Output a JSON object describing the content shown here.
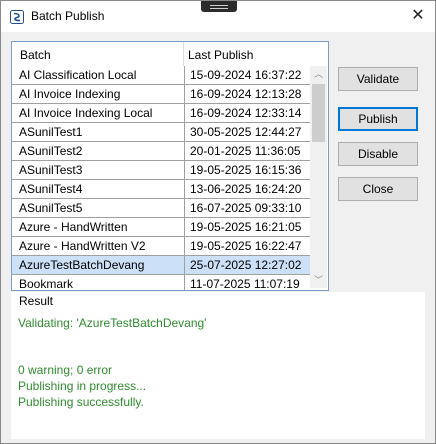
{
  "window": {
    "title": "Batch Publish",
    "close_glyph": "✕"
  },
  "grid": {
    "columns": [
      "Batch",
      "Last Publish"
    ],
    "rows": [
      {
        "batch": "AI Classification Local",
        "last": "15-09-2024 16:37:22"
      },
      {
        "batch": "AI Invoice Indexing",
        "last": "16-09-2024 12:13:28"
      },
      {
        "batch": "AI Invoice Indexing Local",
        "last": "16-09-2024 12:33:14"
      },
      {
        "batch": "ASunilTest1",
        "last": "30-05-2025 12:44:27"
      },
      {
        "batch": "ASunilTest2",
        "last": "20-01-2025 11:36:05"
      },
      {
        "batch": "ASunilTest3",
        "last": "19-05-2025 16:15:36"
      },
      {
        "batch": "ASunilTest4",
        "last": "13-06-2025 16:24:20"
      },
      {
        "batch": "ASunilTest5",
        "last": "16-07-2025 09:33:10"
      },
      {
        "batch": "Azure - HandWritten",
        "last": "19-05-2025 16:21:05"
      },
      {
        "batch": "Azure - HandWritten V2",
        "last": "19-05-2025 16:22:47"
      },
      {
        "batch": "AzureTestBatchDevang",
        "last": "25-07-2025 12:27:02"
      },
      {
        "batch": "Bookmark",
        "last": "11-07-2025 11:07:19"
      }
    ],
    "selected_index": 10,
    "scroll_up_glyph": "︿",
    "scroll_down_glyph": "﹀"
  },
  "buttons": {
    "validate": "Validate",
    "publish": "Publish",
    "disable": "Disable",
    "close": "Close"
  },
  "result": {
    "legend": "Result",
    "line1": "Validating: 'AzureTestBatchDevang'",
    "line2": "0 warning; 0 error",
    "line3": "Publishing in progress...",
    "line4": "Publishing successfully."
  },
  "colors": {
    "selection": "#cce0f7",
    "result_text": "#2e8b2e",
    "default_button_border": "#0078d7"
  },
  "icons": {
    "app": "batch-publish-app-icon",
    "close": "close-icon"
  }
}
